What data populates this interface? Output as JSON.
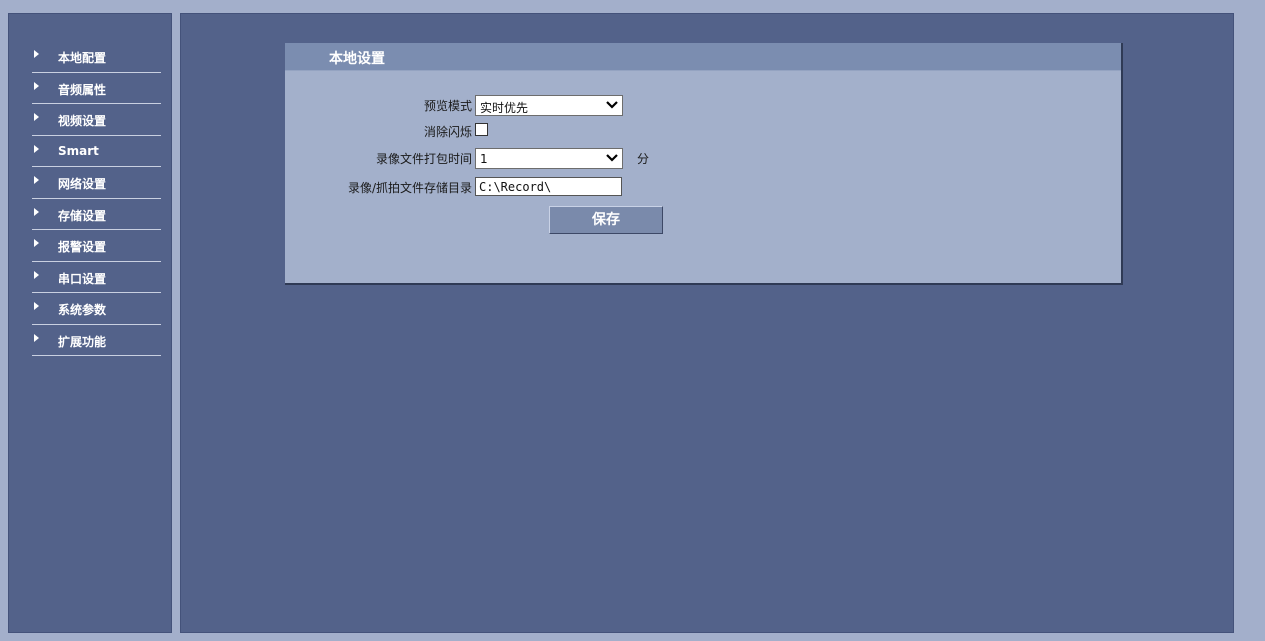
{
  "sidebar": {
    "items": [
      {
        "label": "本地配置"
      },
      {
        "label": "音频属性"
      },
      {
        "label": "视频设置"
      },
      {
        "label": "Smart"
      },
      {
        "label": "网络设置"
      },
      {
        "label": "存储设置"
      },
      {
        "label": "报警设置"
      },
      {
        "label": "串口设置"
      },
      {
        "label": "系统参数"
      },
      {
        "label": "扩展功能"
      }
    ]
  },
  "panel": {
    "title": "本地设置",
    "preview_mode": {
      "label": "预览模式",
      "value": "实时优先"
    },
    "anti_flicker": {
      "label": "消除闪烁",
      "checked": false
    },
    "record_pack_time": {
      "label": "录像文件打包时间",
      "value": "1",
      "unit": "分"
    },
    "storage_dir": {
      "label": "录像/抓拍文件存储目录",
      "value": "C:\\Record\\"
    },
    "save_label": "保存"
  },
  "colors": {
    "background": "#a3afcb",
    "panel_dark": "#53628a",
    "form_bg": "#a3b0cb",
    "header_bg": "#7b8db0",
    "button_bg": "#7a8aab"
  }
}
